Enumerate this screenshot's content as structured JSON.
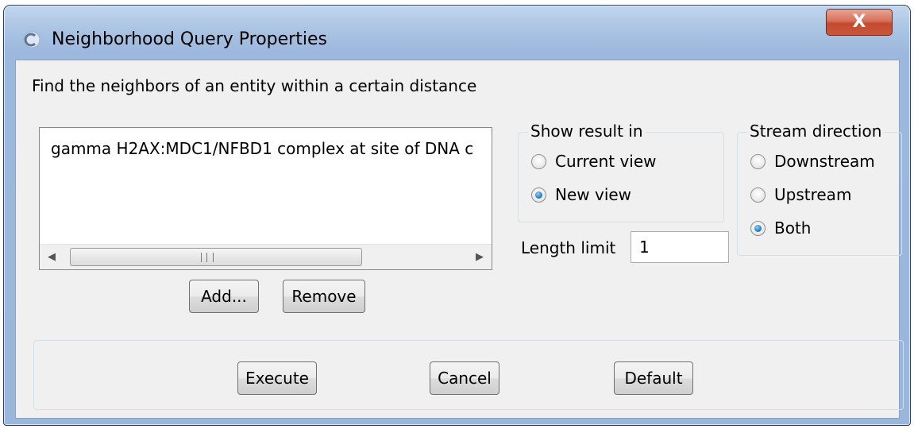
{
  "window": {
    "title": "Neighborhood Query Properties",
    "close_glyph": "X"
  },
  "description": "Find the neighbors of an entity within a certain distance",
  "entity_list": {
    "items": [
      "gamma H2AX:MDC1/NFBD1 complex at site of DNA c"
    ],
    "scroll_grip": "III"
  },
  "list_buttons": {
    "add": "Add...",
    "remove": "Remove"
  },
  "show_result": {
    "legend": "Show result in",
    "options": [
      {
        "label": "Current view",
        "selected": false
      },
      {
        "label": "New view",
        "selected": true
      }
    ]
  },
  "stream_direction": {
    "legend": "Stream direction",
    "options": [
      {
        "label": "Downstream",
        "selected": false
      },
      {
        "label": "Upstream",
        "selected": false
      },
      {
        "label": "Both",
        "selected": true
      }
    ]
  },
  "length_limit": {
    "label": "Length limit",
    "value": "1"
  },
  "actions": {
    "execute": "Execute",
    "cancel": "Cancel",
    "default": "Default"
  },
  "colors": {
    "accent": "#2a7fc0",
    "titlebar": "#a8c2e2",
    "close": "#c9573d"
  }
}
